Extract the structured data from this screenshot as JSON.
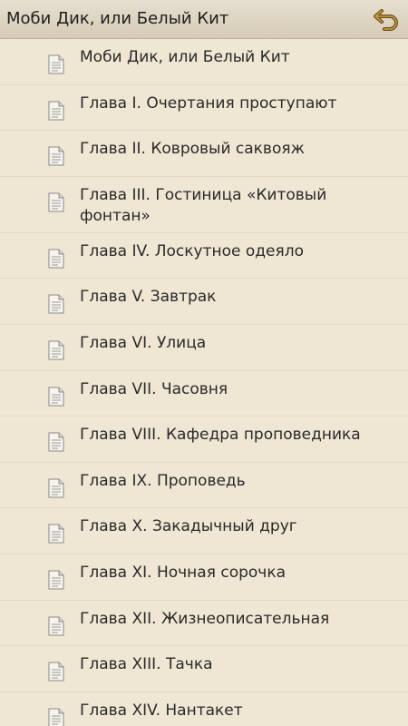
{
  "header": {
    "title": "Моби Дик, или Белый Кит",
    "back_icon": "back-arrow-icon",
    "accent": "#7a5a1e"
  },
  "toc": {
    "items": [
      {
        "label": "Моби Дик, или Белый Кит",
        "icon": "document-icon"
      },
      {
        "label": "Глава I. Очертания проступают",
        "icon": "document-icon"
      },
      {
        "label": "Глава II. Ковровый саквояж",
        "icon": "document-icon"
      },
      {
        "label": "Глава III. Гостиница «Китовый фонтан»",
        "icon": "document-icon"
      },
      {
        "label": "Глава IV. Лоскутное одеяло",
        "icon": "document-icon"
      },
      {
        "label": "Глава V. Завтрак",
        "icon": "document-icon"
      },
      {
        "label": "Глава VI. Улица",
        "icon": "document-icon"
      },
      {
        "label": "Глава VII. Часовня",
        "icon": "document-icon"
      },
      {
        "label": "Глава VIII. Кафедра проповедника",
        "icon": "document-icon"
      },
      {
        "label": "Глава IX. Проповедь",
        "icon": "document-icon"
      },
      {
        "label": "Глава X. Закадычный друг",
        "icon": "document-icon"
      },
      {
        "label": "Глава XI. Ночная сорочка",
        "icon": "document-icon"
      },
      {
        "label": "Глава XII. Жизнеописательная",
        "icon": "document-icon"
      },
      {
        "label": "Глава XIII. Тачка",
        "icon": "document-icon"
      },
      {
        "label": "Глава XIV. Нантакет",
        "icon": "document-icon"
      }
    ]
  }
}
